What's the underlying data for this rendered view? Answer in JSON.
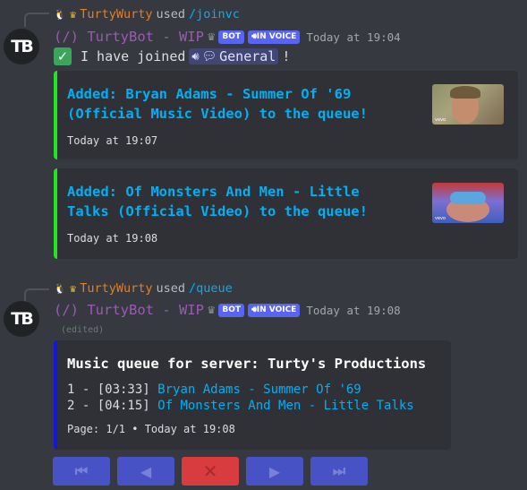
{
  "messages": [
    {
      "reply": {
        "user": "TurtyWurty",
        "used": "used",
        "command": "/joinvc"
      },
      "author": {
        "avatar_text": "TB",
        "name": "(/) TurtyBot - WIP",
        "badges": [
          "BOT",
          "IN VOICE"
        ],
        "timestamp": "Today at 19:04"
      },
      "content": {
        "check": "✓",
        "text_before": "I have joined",
        "channel_name": "General",
        "text_after": "!"
      },
      "embeds": [
        {
          "title_line1": "Added: Bryan Adams - Summer Of '69",
          "title_line2": "(Official Music Video) to the queue!",
          "footer": "Today at 19:07",
          "thumb_label": "vevo",
          "color": "#20e620"
        },
        {
          "title_line1": "Added: Of Monsters And Men - Little",
          "title_line2": "Talks (Official Video) to the queue!",
          "footer": "Today at 19:08",
          "thumb_label": "vevo",
          "color": "#20e620"
        }
      ]
    },
    {
      "reply": {
        "user": "TurtyWurty",
        "used": "used",
        "command": "/queue"
      },
      "author": {
        "avatar_text": "TB",
        "name": "(/) TurtyBot - WIP",
        "badges": [
          "BOT",
          "IN VOICE"
        ],
        "timestamp": "Today at 19:08",
        "edited": "(edited)"
      },
      "queue_embed": {
        "title": "Music queue for server: Turty's Productions",
        "rows": [
          {
            "prefix": "1 - [03:33] ",
            "song": "Bryan Adams - Summer Of '69"
          },
          {
            "prefix": "2 - [04:15] ",
            "song": "Of Monsters And Men - Little Talks"
          }
        ],
        "footer": "Page: 1/1 • Today at 19:08",
        "color": "#1515e0"
      },
      "buttons": [
        {
          "icon": "first-page-icon",
          "glyph": "⏮"
        },
        {
          "icon": "previous-icon",
          "glyph": "◀"
        },
        {
          "icon": "close-icon",
          "glyph": "✕"
        },
        {
          "icon": "next-icon",
          "glyph": "▶"
        },
        {
          "icon": "last-page-icon",
          "glyph": "⏭"
        }
      ]
    }
  ],
  "colors": {
    "background": "#36393f",
    "embed_bg": "#2f3136",
    "link": "#00aff4",
    "bot_name": "#9b59b6",
    "user_name": "#e67e22",
    "badge": "#5865f2",
    "button_blue": "#4752c4",
    "button_red": "#d83c3e"
  }
}
